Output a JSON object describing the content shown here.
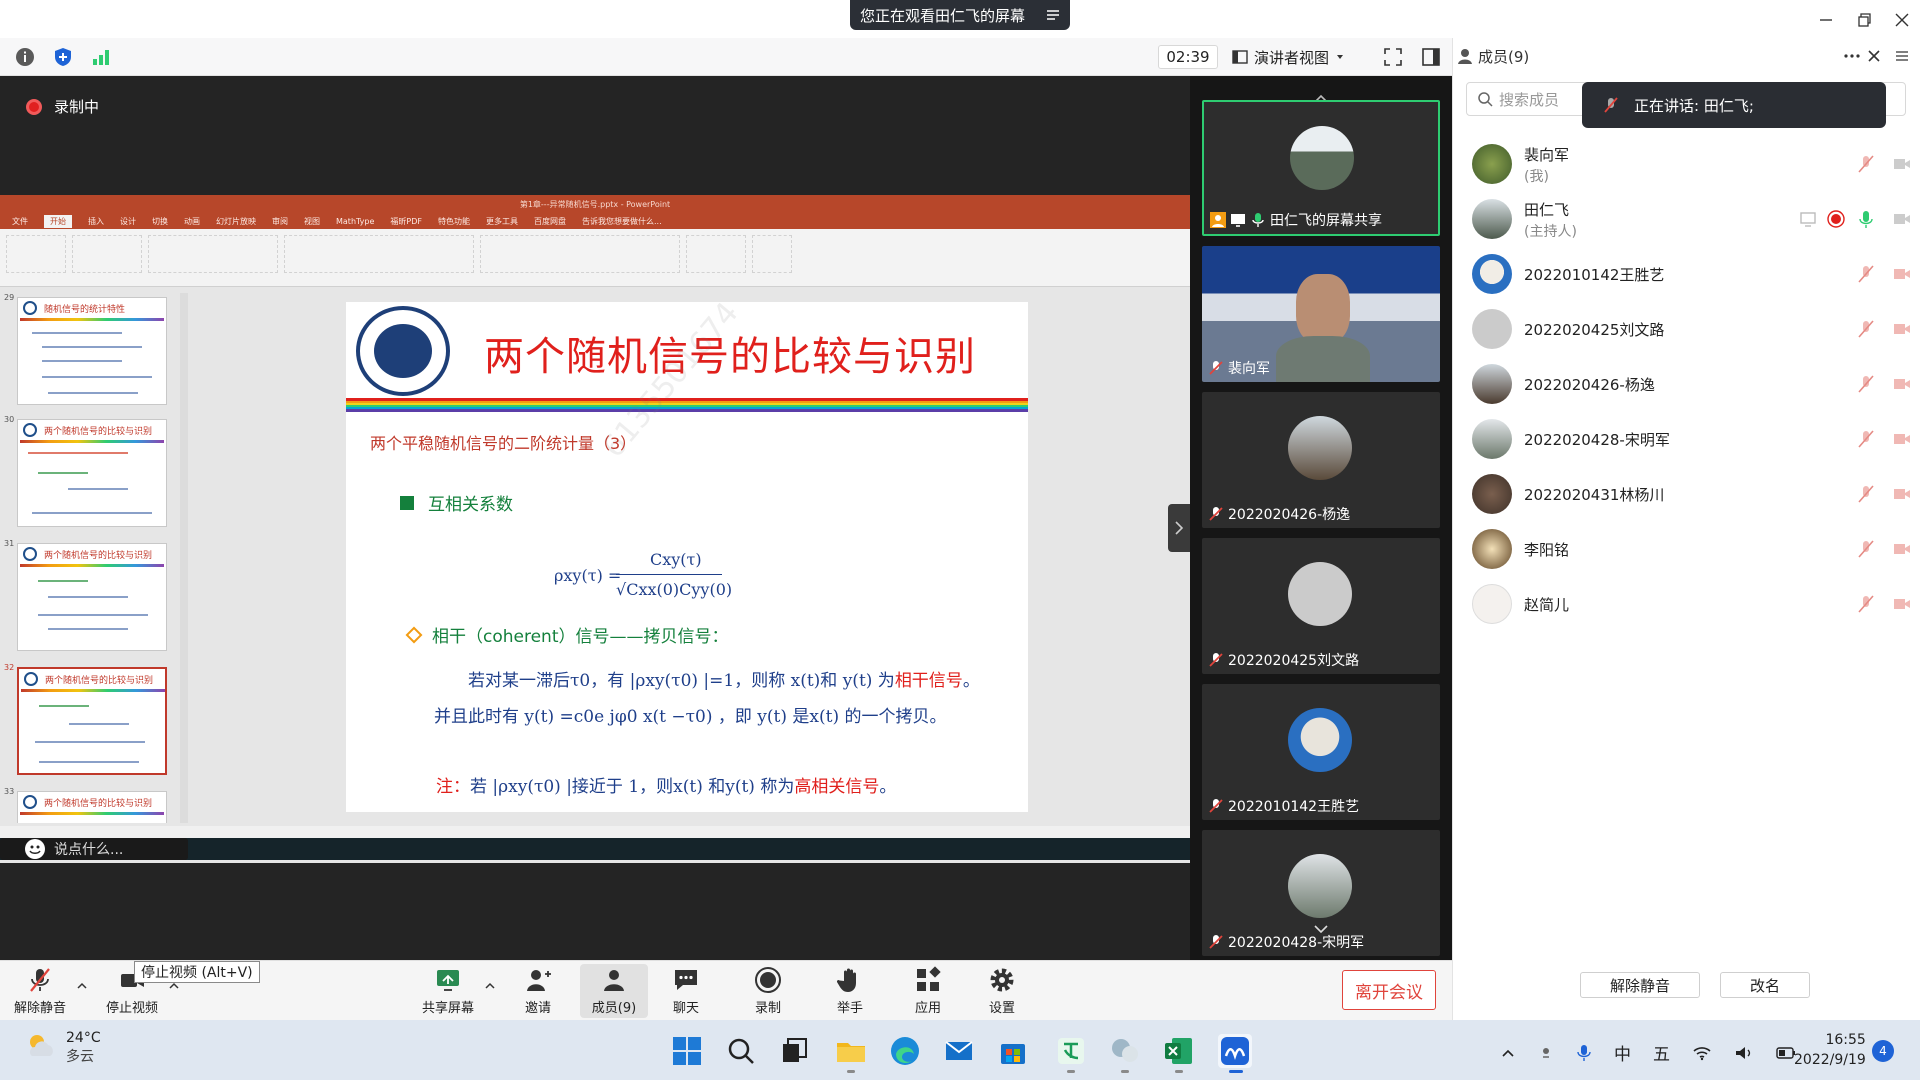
{
  "window": {
    "viewing_banner": "您正在观看田仁飞的屏幕",
    "timer": "02:39",
    "speaker_view": "演讲者视图"
  },
  "recording": {
    "label": "录制中"
  },
  "ppt": {
    "title_bar": "第1章---异常随机信号.pptx - PowerPoint",
    "tabs": [
      "文件",
      "开始",
      "插入",
      "设计",
      "切换",
      "动画",
      "幻灯片放映",
      "审阅",
      "视图",
      "MathType",
      "福昕PDF",
      "特色功能",
      "更多工具",
      "百度网盘",
      "告诉我您想要做什么..."
    ],
    "thumbnails": [
      {
        "num": "29",
        "title": "随机信号的统计特性"
      },
      {
        "num": "30",
        "title": "两个随机信号的比较与识别"
      },
      {
        "num": "31",
        "title": "两个随机信号的比较与识别"
      },
      {
        "num": "32",
        "title": "两个随机信号的比较与识别"
      },
      {
        "num": "33",
        "title": "两个随机信号的比较与识别"
      }
    ],
    "comment_placeholder": "说点什么..."
  },
  "slide": {
    "title": "两个随机信号的比较与识别",
    "subtitle": "两个平稳随机信号的二阶统计量（3）",
    "bullet": "互相关系数",
    "formula_lhs": "ρxy(τ) =",
    "formula_num": "Cxy(τ)",
    "formula_den": "√Cxx(0)Cyy(0)",
    "coherent": "相干（coherent）信号——拷贝信号：",
    "line1_a": "若对某一滞后τ0，有 |ρxy(τ0) |=1，则称 x(t)和 y(t) 为",
    "line1_red": "相干信号",
    "line1_end": "。",
    "line2": "并且此时有 y(t) =c0e jφ0 x(t −τ0) ，即 y(t) 是x(t) 的一个拷贝。",
    "note_label": "注：",
    "note_text": "若 |ρxy(τ0) |接近于 1，则x(t) 和y(t) 称为",
    "note_red": "高相关信号",
    "note_end": "。",
    "watermark": "6135501674"
  },
  "video_tiles": [
    {
      "name": "田仁飞的屏幕共享"
    },
    {
      "name": "裴向军"
    },
    {
      "name": "2022020426-杨逸"
    },
    {
      "name": "2022020425刘文路"
    },
    {
      "name": "2022010142王胜艺"
    },
    {
      "name": "2022020428-宋明军"
    }
  ],
  "members_panel": {
    "title": "成员(9)",
    "search_placeholder": "搜索成员",
    "speaking": "正在讲话: 田仁飞;",
    "members": [
      {
        "name": "裴向军",
        "sub": "(我)"
      },
      {
        "name": "田仁飞",
        "sub": "(主持人)"
      },
      {
        "name": "2022010142王胜艺",
        "sub": ""
      },
      {
        "name": "2022020425刘文路",
        "sub": ""
      },
      {
        "name": "2022020426-杨逸",
        "sub": ""
      },
      {
        "name": "2022020428-宋明军",
        "sub": ""
      },
      {
        "name": "2022020431林杨川",
        "sub": ""
      },
      {
        "name": "李阳铭",
        "sub": ""
      },
      {
        "name": "赵简儿",
        "sub": ""
      }
    ],
    "unmute_all": "解除静音",
    "rename": "改名"
  },
  "meeting_toolbar": {
    "unmute": "解除静音",
    "stop_video": "停止视频",
    "tooltip": "停止视频 (Alt+V)",
    "share": "共享屏幕",
    "invite": "邀请",
    "members": "成员(9)",
    "chat": "聊天",
    "record": "录制",
    "raise_hand": "举手",
    "apps": "应用",
    "settings": "设置",
    "leave": "离开会议"
  },
  "taskbar": {
    "temp": "24°C",
    "weather": "多云",
    "ime1": "中",
    "ime2": "五",
    "time": "16:55",
    "date": "2022/9/19",
    "notifications": "4"
  },
  "colors": {
    "accent_red": "#e0201c",
    "leave_red": "#e0443c",
    "active_green": "#2ecc71",
    "ppt_brand": "#b7472a"
  }
}
